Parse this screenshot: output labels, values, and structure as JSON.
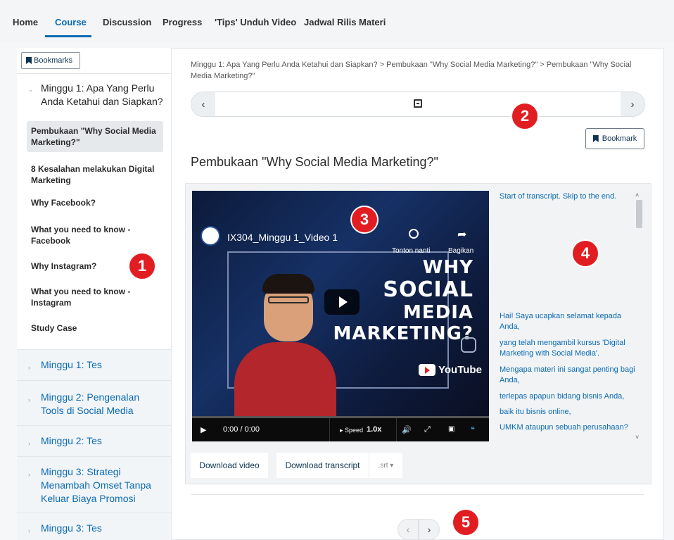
{
  "nav": {
    "tabs": [
      {
        "label": "Home"
      },
      {
        "label": "Course"
      },
      {
        "label": "Discussion"
      },
      {
        "label": "Progress"
      },
      {
        "label": "'Tips' Unduh Video"
      },
      {
        "label": "Jadwal Rilis Materi"
      }
    ],
    "active": "Course"
  },
  "sidebar": {
    "bookmarks_label": "Bookmarks",
    "open_week": "Minggu 1: Apa Yang Perlu Anda Ketahui dan Siapkan?",
    "units": [
      {
        "label": "Pembukaan \"Why Social Media Marketing?\"",
        "active": true
      },
      {
        "label": "8 Kesalahan melakukan Digital Marketing"
      },
      {
        "label": "Why Facebook?"
      },
      {
        "label": "What you need to know - Facebook"
      },
      {
        "label": "Why Instagram?"
      },
      {
        "label": "What you need to know - Instagram"
      },
      {
        "label": "Study Case"
      }
    ],
    "closed_weeks": [
      {
        "label": "Minggu 1: Tes"
      },
      {
        "label": "Minggu 2: Pengenalan Tools di Social Media"
      },
      {
        "label": "Minggu 2: Tes"
      },
      {
        "label": "Minggu 3: Strategi Menambah Omset Tanpa Keluar Biaya Promosi"
      },
      {
        "label": "Minggu 3: Tes"
      }
    ]
  },
  "breadcrumb": "Minggu 1: Apa Yang Perlu Anda Ketahui dan Siapkan? > Pembukaan \"Why Social Media Marketing?\" > Pembukaan \"Why Social Media Marketing?\"",
  "bookmark_label": "Bookmark",
  "unit_title": "Pembukaan \"Why Social Media Marketing?\"",
  "video": {
    "title": "IX304_Minggu 1_Video 1",
    "watch_later": "Tonton nanti",
    "share": "Bagikan",
    "big_text": [
      "WHY",
      "SOCIAL",
      "MEDIA",
      "MARKETING?"
    ],
    "youtube": "YouTube",
    "time": "0:00 / 0:00",
    "speed_label": "Speed",
    "speed_value": "1.0x"
  },
  "transcript": {
    "skip": "Start of transcript. Skip to the end.",
    "lines": [
      "Hai! Saya ucapkan selamat kepada Anda,",
      "yang telah mengambil kursus 'Digital Marketing with Social Media'.",
      "Mengapa materi ini sangat penting bagi Anda,",
      "terlepas apapun bidang bisnis Anda,",
      "baik itu bisnis online,",
      "UMKM ataupun sebuah perusahaan?"
    ]
  },
  "downloads": {
    "video": "Download video",
    "transcript": "Download transcript",
    "format": ".srt"
  },
  "badges": [
    "1",
    "2",
    "3",
    "4",
    "5"
  ],
  "colors": {
    "accent": "#0a6ab3",
    "badge": "#e21d22",
    "text": "#313131"
  }
}
